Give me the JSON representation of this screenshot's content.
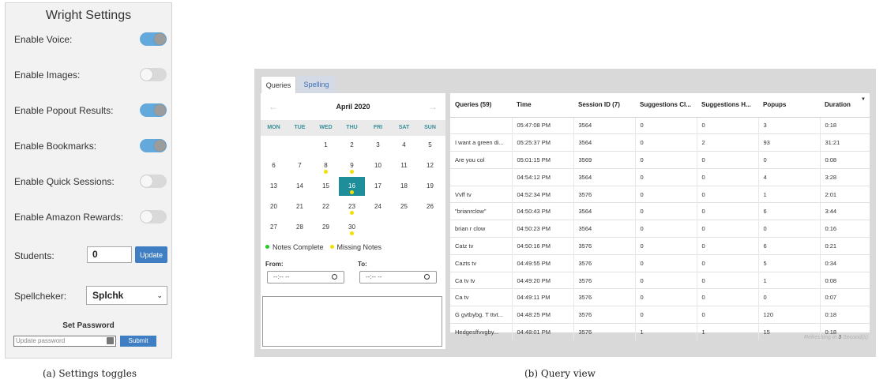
{
  "settings": {
    "title": "Wright Settings",
    "toggles": [
      {
        "label": "Enable Voice:",
        "on": true
      },
      {
        "label": "Enable Images:",
        "on": false
      },
      {
        "label": "Enable Popout Results:",
        "on": true
      },
      {
        "label": "Enable Bookmarks:",
        "on": true
      },
      {
        "label": "Enable Quick Sessions:",
        "on": false
      },
      {
        "label": "Enable Amazon Rewards:",
        "on": false
      }
    ],
    "students_label": "Students:",
    "students_value": "0",
    "update_label": "Update",
    "spellchecker_label": "Spellcheker:",
    "spellchecker_value": "Splchk",
    "set_password_title": "Set Password",
    "password_placeholder": "Update password",
    "submit_label": "Submit",
    "caption": "(a) Settings toggles"
  },
  "query_view": {
    "caption": "(b) Query view",
    "tabs": [
      {
        "label": "Queries",
        "active": true
      },
      {
        "label": "Spelling",
        "active": false
      }
    ],
    "calendar": {
      "month": "April 2020",
      "prev_icon": "←",
      "next_icon": "→",
      "weekdays": [
        "MON",
        "TUE",
        "WED",
        "THU",
        "FRI",
        "SAT",
        "SUN"
      ],
      "weeks": [
        [
          "",
          "",
          "1",
          "2",
          "3",
          "4",
          "5"
        ],
        [
          "6",
          "7",
          "8",
          "9",
          "10",
          "11",
          "12"
        ],
        [
          "13",
          "14",
          "15",
          "16",
          "17",
          "18",
          "19"
        ],
        [
          "20",
          "21",
          "22",
          "23",
          "24",
          "25",
          "26"
        ],
        [
          "27",
          "28",
          "29",
          "30",
          "",
          "",
          ""
        ]
      ],
      "selected_day": "16",
      "missing_notes_days": [
        "8",
        "9",
        "16",
        "23",
        "30"
      ]
    },
    "legend": {
      "complete_label": "Notes Complete",
      "complete_color": "#22cc22",
      "missing_label": "Missing Notes",
      "missing_color": "#f2e000"
    },
    "from_label": "From:",
    "to_label": "To:",
    "time_placeholder": "--:-- --",
    "table": {
      "columns": [
        "Queries (59)",
        "Time",
        "Session ID (7)",
        "Suggestions Cl...",
        "Suggestions H...",
        "Popups",
        "Duration"
      ],
      "rows": [
        [
          "",
          "05:47:08 PM",
          "3564",
          "0",
          "0",
          "3",
          "0:18"
        ],
        [
          "I want a green di...",
          "05:25:37 PM",
          "3564",
          "0",
          "2",
          "93",
          "31:21"
        ],
        [
          "Are you col",
          "05:01:15 PM",
          "3569",
          "0",
          "0",
          "0",
          "0:08"
        ],
        [
          "",
          "04:54:12 PM",
          "3564",
          "0",
          "0",
          "4",
          "3:28"
        ],
        [
          "Vvff tv",
          "04:52:34 PM",
          "3576",
          "0",
          "0",
          "1",
          "2:01"
        ],
        [
          "\"brianrclow\"",
          "04:50:43 PM",
          "3564",
          "0",
          "0",
          "6",
          "3:44"
        ],
        [
          "brian r clow",
          "04:50:23 PM",
          "3564",
          "0",
          "0",
          "0",
          "0:16"
        ],
        [
          "Catz tv",
          "04:50:16 PM",
          "3576",
          "0",
          "0",
          "6",
          "0:21"
        ],
        [
          "Cazts tv",
          "04:49:55 PM",
          "3576",
          "0",
          "0",
          "5",
          "0:34"
        ],
        [
          "Ca tv tv",
          "04:49:20 PM",
          "3576",
          "0",
          "0",
          "1",
          "0:08"
        ],
        [
          "Ca tv",
          "04:49:11 PM",
          "3576",
          "0",
          "0",
          "0",
          "0:07"
        ],
        [
          "G gvtbybg. T ttvt...",
          "04:48:25 PM",
          "3576",
          "0",
          "0",
          "120",
          "0:18"
        ],
        [
          "Hedgesffvvgby...",
          "04:48:01 PM",
          "3576",
          "1",
          "1",
          "15",
          "0:18"
        ]
      ]
    },
    "refresh": {
      "prefix": "Refreshing in ",
      "seconds": "3",
      "suffix": " Second(s)"
    }
  }
}
